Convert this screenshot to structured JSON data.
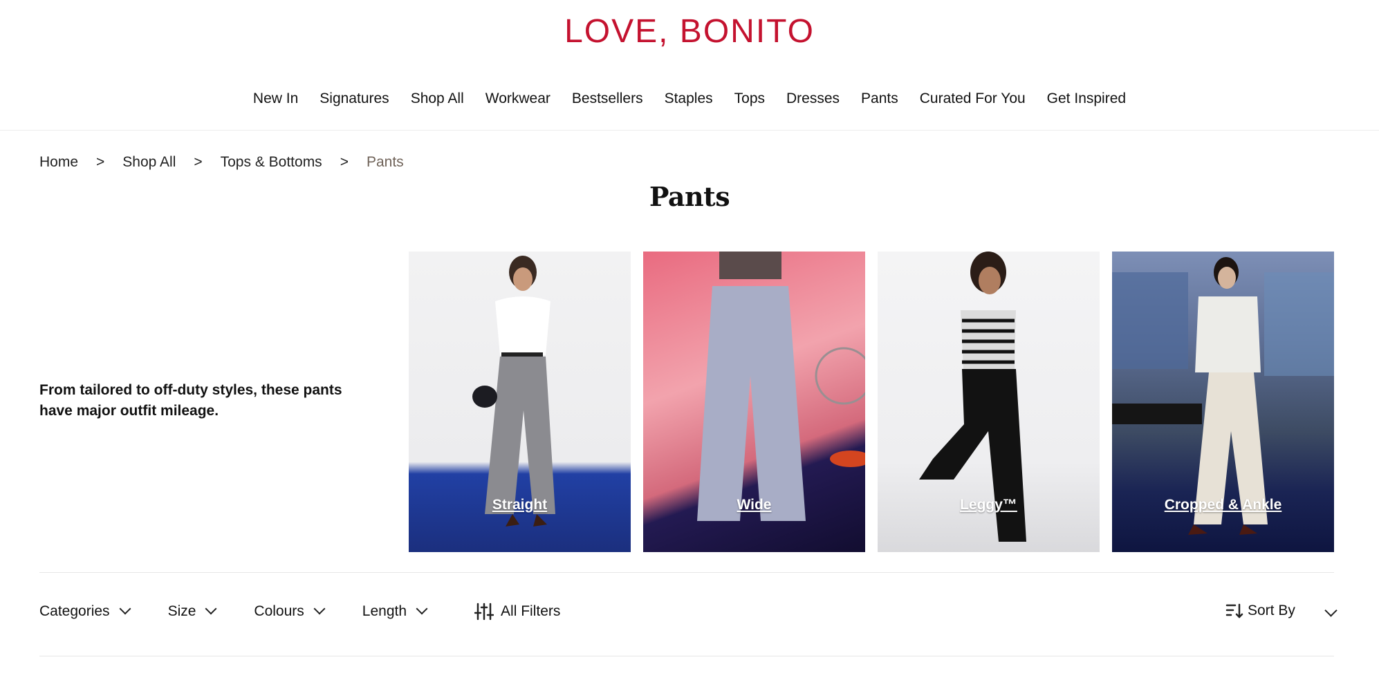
{
  "brand": {
    "logo_text": "LOVE, BONITO",
    "color": "#c4122f"
  },
  "nav": {
    "items": [
      {
        "label": "New In"
      },
      {
        "label": "Signatures"
      },
      {
        "label": "Shop All"
      },
      {
        "label": "Workwear"
      },
      {
        "label": "Bestsellers"
      },
      {
        "label": "Staples"
      },
      {
        "label": "Tops"
      },
      {
        "label": "Dresses"
      },
      {
        "label": "Pants"
      },
      {
        "label": "Curated For You"
      },
      {
        "label": "Get Inspired"
      }
    ]
  },
  "breadcrumb": {
    "items": [
      {
        "label": "Home"
      },
      {
        "label": "Shop All"
      },
      {
        "label": "Tops & Bottoms"
      },
      {
        "label": "Pants"
      }
    ],
    "separator": ">"
  },
  "page": {
    "title": "Pants",
    "intro": "From tailored to off-duty styles, these pants have major outfit mileage."
  },
  "categories": [
    {
      "label": "Straight"
    },
    {
      "label": "Wide"
    },
    {
      "label": "Leggy™"
    },
    {
      "label": "Cropped & Ankle"
    }
  ],
  "filters": {
    "categories": "Categories",
    "size": "Size",
    "colours": "Colours",
    "length": "Length",
    "all_filters": "All Filters",
    "sort_by": "Sort By"
  }
}
